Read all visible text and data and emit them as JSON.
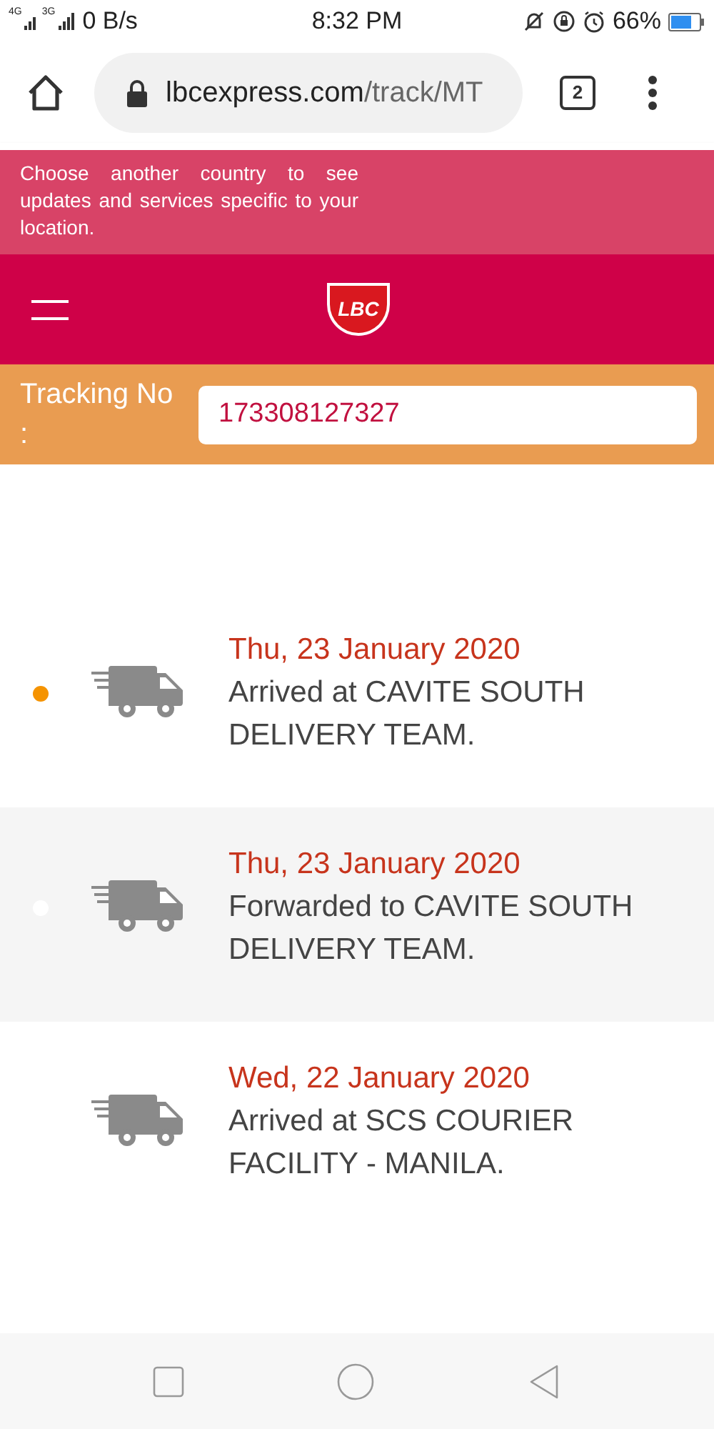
{
  "status_bar": {
    "network_labels": [
      "4G",
      "3G"
    ],
    "speed": "0 B/s",
    "time": "8:32 PM",
    "battery": "66%"
  },
  "browser": {
    "url_host": "lbcexpress.com",
    "url_path": "/track/MT",
    "tab_count": "2"
  },
  "country_banner": {
    "text": "Choose another country to see updates and services specific to your location."
  },
  "header": {
    "logo_text": "LBC"
  },
  "tracking": {
    "label": "Tracking No :",
    "value": "173308127327"
  },
  "events": [
    {
      "date": "Thu, 23 January 2020",
      "description": "Arrived at CAVITE SOUTH DELIVERY TEAM.",
      "color": "#f59300"
    },
    {
      "date": "Thu, 23 January 2020",
      "description": "Forwarded to CAVITE SOUTH DELIVERY TEAM.",
      "color": "#ffffff"
    },
    {
      "date": "Wed, 22 January 2020",
      "description": "Arrived at SCS COURIER FACILITY - MANILA."
    }
  ]
}
